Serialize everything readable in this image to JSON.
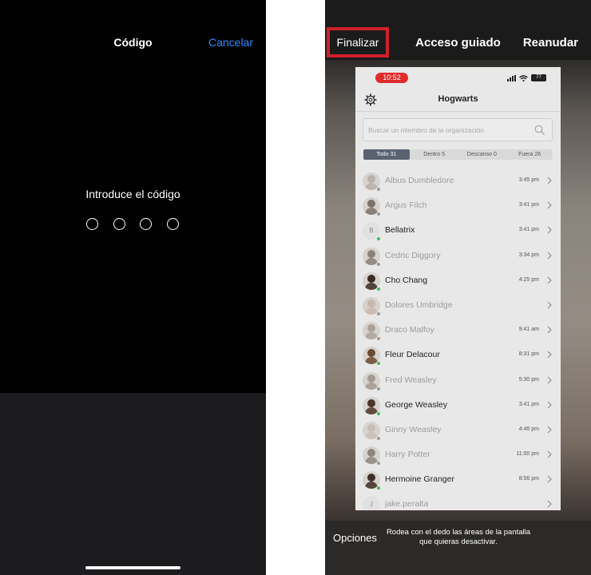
{
  "passcode": {
    "title": "Código",
    "cancel_label": "Cancelar",
    "prompt": "Introduce el código",
    "digit_count": 4
  },
  "guided_access": {
    "finish_label": "Finalizar",
    "title": "Acceso guiado",
    "resume_label": "Reanudar",
    "options_label": "Opciones",
    "hint": "Rodea con el dedo las áreas de la pantalla que quieras desactivar.",
    "highlight_color": "#d0202a"
  },
  "app": {
    "status_time": "10:52",
    "battery": "77",
    "title": "Hogwarts",
    "search_placeholder": "Buscar un miembro de la organización",
    "segments": [
      {
        "label": "Todo 31",
        "active": true
      },
      {
        "label": "Dentro 5",
        "active": false
      },
      {
        "label": "Descanso 0",
        "active": false
      },
      {
        "label": "Fuera 26",
        "active": false
      }
    ],
    "members": [
      {
        "name": "Albus Dumbledore",
        "time": "3:45 pm",
        "status": "out",
        "avatar": "#b7b2ad"
      },
      {
        "name": "Argus Filch",
        "time": "3:41 pm",
        "status": "out",
        "avatar": "#7c7267"
      },
      {
        "name": "Bellatrix",
        "time": "3:41 pm",
        "status": "in",
        "avatar": "initial",
        "initial": "B"
      },
      {
        "name": "Cedric Diggory",
        "time": "3:34 pm",
        "status": "out",
        "avatar": "#8a8178"
      },
      {
        "name": "Cho Chang",
        "time": "4:25 pm",
        "status": "in",
        "avatar": "#3c2a24"
      },
      {
        "name": "Dolores Umbridge",
        "time": "",
        "status": "out",
        "avatar": "#c9b7ae"
      },
      {
        "name": "Draco Malfoy",
        "time": "9:41 am",
        "status": "out",
        "avatar": "#aaa39b"
      },
      {
        "name": "Fleur Delacour",
        "time": "8:31 pm",
        "status": "in",
        "avatar": "#6a4a30"
      },
      {
        "name": "Fred Weasley",
        "time": "5:30 pm",
        "status": "out",
        "avatar": "#a59a90"
      },
      {
        "name": "George Weasley",
        "time": "3:41 pm",
        "status": "in",
        "avatar": "#4a3426"
      },
      {
        "name": "Ginny Weasley",
        "time": "4:46 pm",
        "status": "out",
        "avatar": "#c8beb6"
      },
      {
        "name": "Harry Potter",
        "time": "11:00 pm",
        "status": "out",
        "avatar": "#8e8680"
      },
      {
        "name": "Hermoine Granger",
        "time": "8:56 pm",
        "status": "in",
        "avatar": "#3d2e26"
      },
      {
        "name": "jake.peralta",
        "time": "",
        "status": "out",
        "avatar": "initial",
        "initial": "J"
      }
    ]
  }
}
